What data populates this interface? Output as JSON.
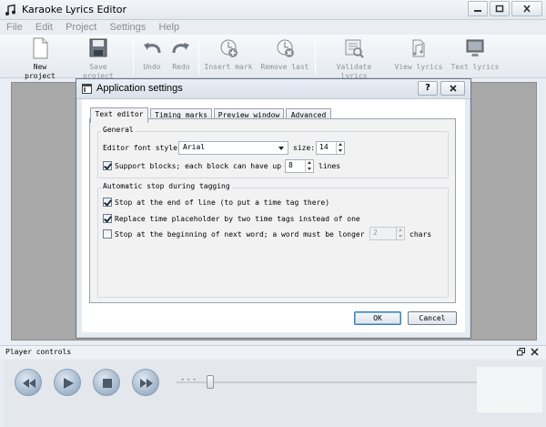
{
  "window": {
    "title": "Karaoke Lyrics Editor"
  },
  "menu": [
    "File",
    "Edit",
    "Project",
    "Settings",
    "Help"
  ],
  "toolbar": {
    "new_project": "New project",
    "save_project": "Save project",
    "undo": "Undo",
    "redo": "Redo",
    "insert_mark": "Insert mark",
    "remove_last": "Remove last",
    "validate_lyrics": "Validate lyrics",
    "view_lyrics": "View lyrics",
    "text_lyrics": "Text lyrics"
  },
  "dialog": {
    "title": "Application settings",
    "help_glyph": "?",
    "tabs": [
      "Text editor",
      "Timing marks",
      "Preview window",
      "Advanced"
    ],
    "active_tab": "Text editor",
    "general": {
      "title": "General",
      "font_style_label": "Editor font style:",
      "font_style_value": "Arial",
      "size_label": "size:",
      "size_value": "14",
      "support_blocks_label": "Support blocks; each block can have up to",
      "support_blocks_checked": true,
      "block_lines_value": "8",
      "lines_label": "lines"
    },
    "auto_stop": {
      "title": "Automatic stop during tagging",
      "option1_label": "Stop at the end of line (to put a time tag there)",
      "option1_checked": true,
      "option2_label": "Replace time placeholder by two time tags instead of one",
      "option2_checked": true,
      "option3_label": "Stop at the beginning of next word; a word must be longer than",
      "option3_checked": false,
      "min_chars_value": "2",
      "chars_label": "chars"
    },
    "ok_label": "OK",
    "cancel_label": "Cancel"
  },
  "player": {
    "title": "Player controls",
    "position_text": "---"
  }
}
